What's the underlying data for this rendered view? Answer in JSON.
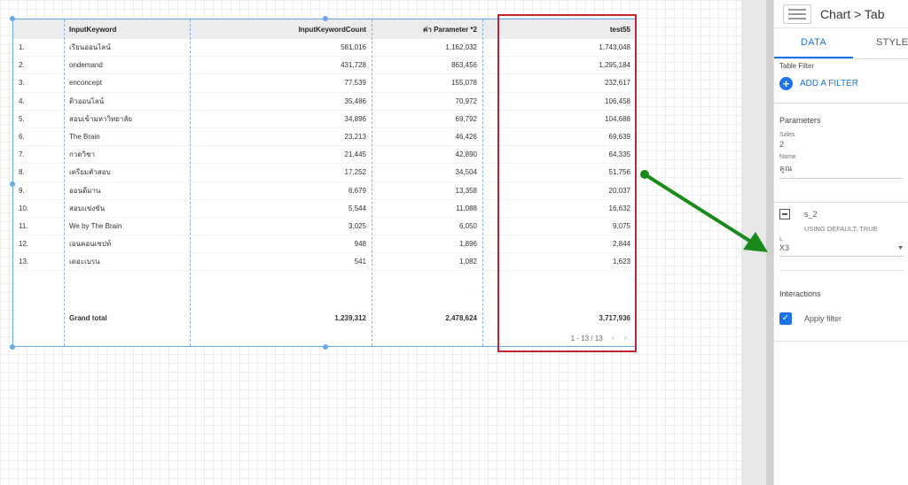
{
  "table": {
    "headers": [
      "",
      "InputKeyword",
      "InputKeywordCount",
      "ค่า Parameter *2",
      "test55"
    ],
    "rows": [
      [
        "1.",
        "เรียนออนไลน์",
        "581,016",
        "1,162,032",
        "1,743,048"
      ],
      [
        "2.",
        "ondemand",
        "431,728",
        "863,456",
        "1,295,184"
      ],
      [
        "3.",
        "enconcept",
        "77,539",
        "155,078",
        "232,617"
      ],
      [
        "4.",
        "ติวออนไลน์",
        "35,486",
        "70,972",
        "106,458"
      ],
      [
        "5.",
        "สอบเข้ามหาวิทยาลัย",
        "34,896",
        "69,792",
        "104,688"
      ],
      [
        "6.",
        "The Brain",
        "23,213",
        "46,426",
        "69,639"
      ],
      [
        "7.",
        "กวดวิชา",
        "21,445",
        "42,890",
        "64,335"
      ],
      [
        "8.",
        "เตรียมตัวสอบ",
        "17,252",
        "34,504",
        "51,756"
      ],
      [
        "9.",
        "ออนดีมาน",
        "6,679",
        "13,358",
        "20,037"
      ],
      [
        "10.",
        "สอบแข่งขัน",
        "5,544",
        "11,088",
        "16,632"
      ],
      [
        "11.",
        "We by The Brain",
        "3,025",
        "6,050",
        "9,075"
      ],
      [
        "12.",
        "เอนคอนเซปท์",
        "948",
        "1,896",
        "2,844"
      ],
      [
        "13.",
        "เดอะเบรน",
        "541",
        "1,082",
        "1,623"
      ]
    ],
    "grand_total": [
      "",
      "Grand total",
      "1,239,312",
      "2,478,624",
      "3,717,936"
    ],
    "pagination": "1 - 13 / 13",
    "prev_icon": "‹",
    "next_icon": "›"
  },
  "panel": {
    "breadcrumb": "Chart > Tab",
    "tabs": [
      "DATA",
      "STYLE"
    ],
    "table_filter": {
      "title": "Table Filter",
      "add_filter": "ADD A FILTER"
    },
    "parameters": {
      "title": "Parameters",
      "sales_label": "Sales",
      "sales_value": "2",
      "name_label": "Name",
      "name_value": "คูณ",
      "s2_label": "s_2",
      "s2_default": "USING DEFAULT: TRUE",
      "l_label": "L",
      "l_value": "X3"
    },
    "interactions": {
      "title": "Interactions",
      "apply_filter": "Apply filter"
    }
  },
  "colors": {
    "accent": "#1a73e8",
    "highlight_border": "#c0262d",
    "arrow": "#1a8a1a"
  }
}
